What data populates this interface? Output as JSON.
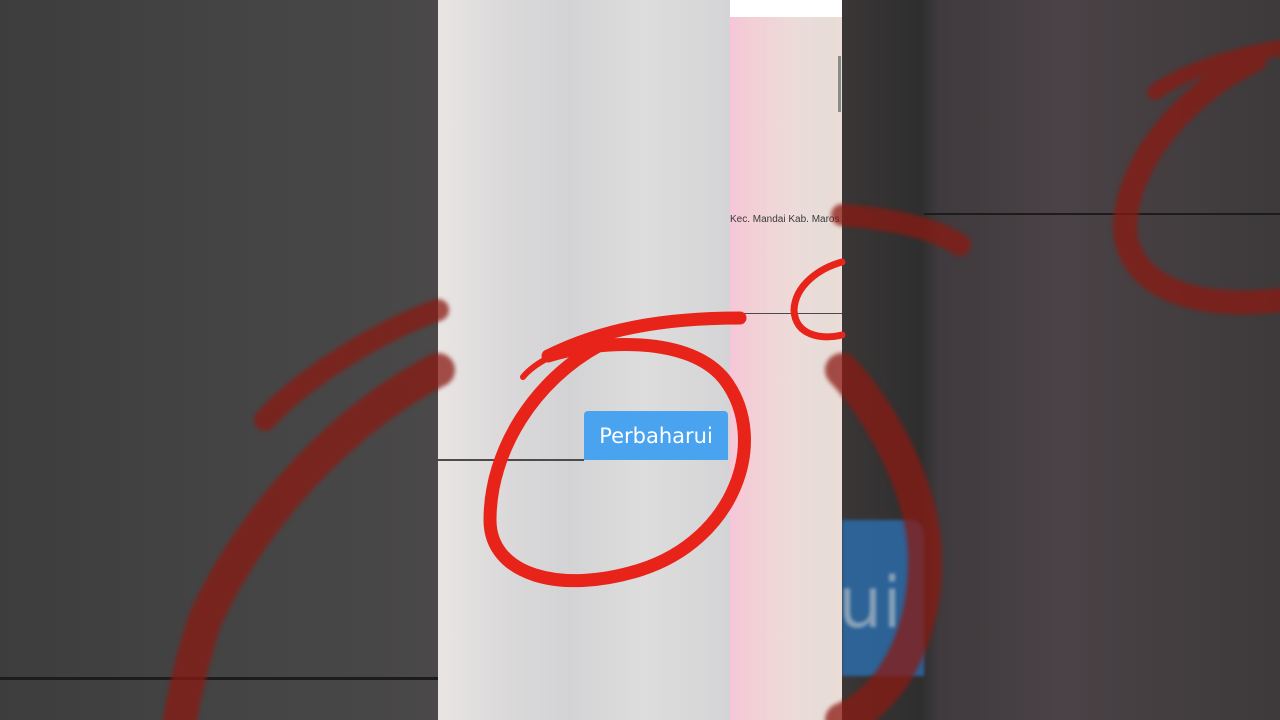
{
  "screen": {
    "address_text": "Kec. Mandai Kab. Maros",
    "update_button_label": "Perbaharui",
    "side_button_fragment": "ui"
  },
  "annotation": {
    "shape": "hand-drawn circle",
    "color": "#e8241a"
  },
  "colors": {
    "button_blue": "#4aa3ee",
    "pink_panel": "#f6c6d8"
  }
}
